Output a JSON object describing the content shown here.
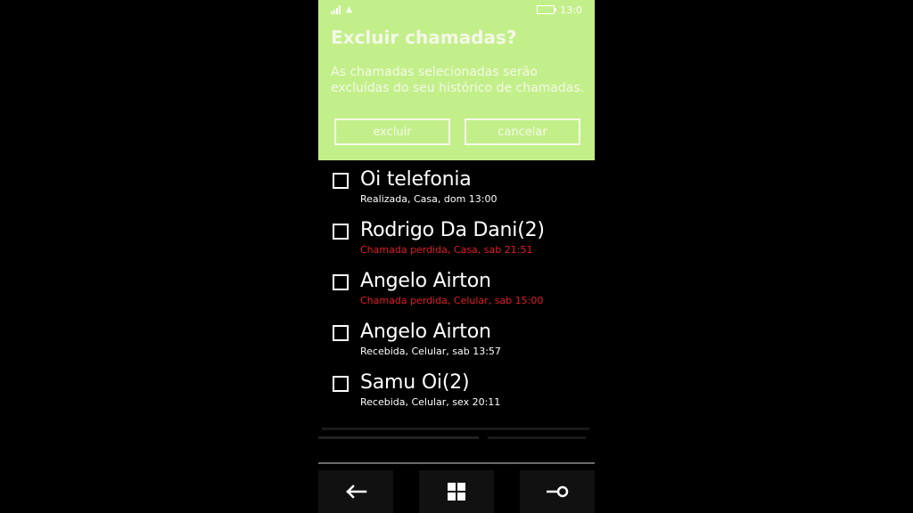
{
  "status_bar": {
    "time": "13:0"
  },
  "dialog": {
    "title": "Excluir chamadas?",
    "message": "As chamadas selecionadas serão excluídas do seu histórico de chamadas.",
    "ok_label": "excluir",
    "cancel_label": "cancelar"
  },
  "calls": [
    {
      "name": "Oi telefonia",
      "detail": "Realizada, Casa, dom 13:00",
      "missed": false
    },
    {
      "name": "Rodrigo Da Dani(2)",
      "detail": "Chamada perdida, Casa, sab 21:51",
      "missed": true
    },
    {
      "name": "Angelo Airton",
      "detail": "Chamada perdida, Celular, sab 15:00",
      "missed": true
    },
    {
      "name": "Angelo Airton",
      "detail": "Recebida, Celular, sab 13:57",
      "missed": false
    },
    {
      "name": "Samu Oi(2)",
      "detail": "Recebida, Celular, sex 20:11",
      "missed": false
    }
  ],
  "nav": {
    "back_icon": "back-arrow-icon",
    "home_icon": "windows-logo-icon",
    "search_icon": "search-icon"
  },
  "colors": {
    "dialog_bg": "#c3ef8a",
    "missed": "#e21c24"
  }
}
